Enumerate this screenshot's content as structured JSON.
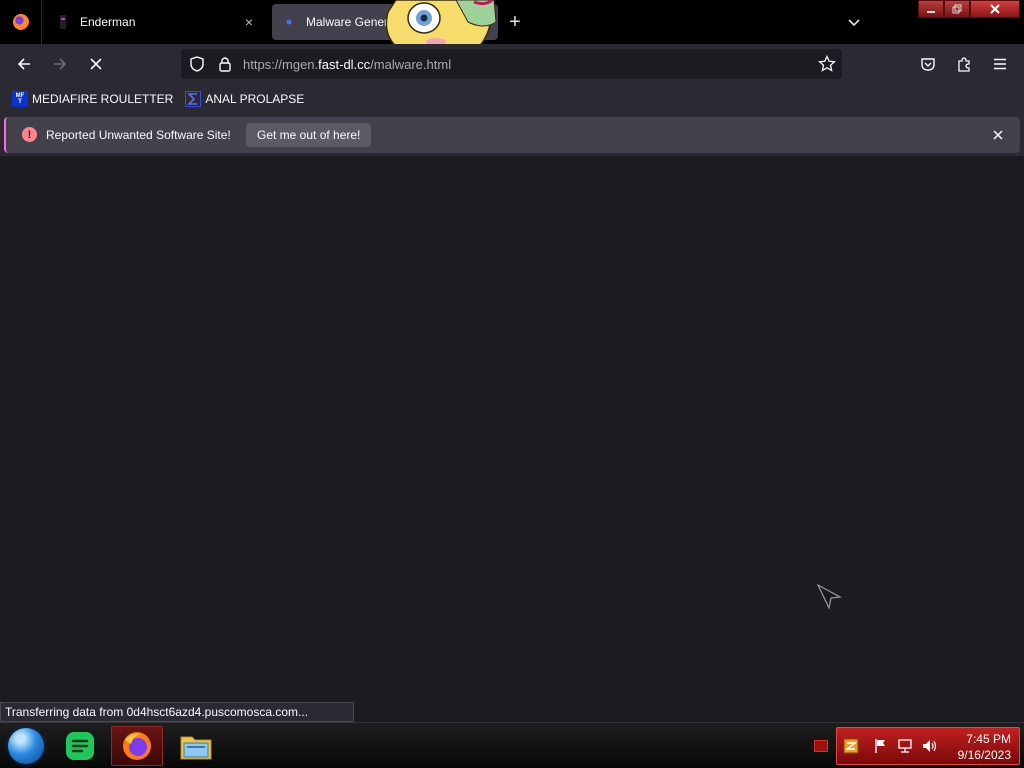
{
  "tabs": [
    {
      "title": "Enderman",
      "active": false
    },
    {
      "title": "Malware Generator",
      "active": true
    }
  ],
  "tab_close_glyph": "×",
  "new_tab_glyph": "+",
  "url": {
    "prefix": "https://mgen.",
    "host": "fast-dl.cc",
    "path": "/malware.html"
  },
  "bookmarks": [
    {
      "label": "MEDIAFIRE ROULETTER",
      "icon": "mediafire-roulette-icon",
      "icon_text": "MF T"
    },
    {
      "label": "ANAL PROLAPSE",
      "icon": "sigma-bookmark-icon"
    }
  ],
  "warning": {
    "text": "Reported Unwanted Software Site!",
    "button": "Get me out of here!",
    "icon_glyph": "!"
  },
  "status_text": "Transferring data from 0d4hsct6azd4.puscomosca.com...",
  "clock": {
    "time": "7:45 PM",
    "date": "9/16/2023"
  },
  "colors": {
    "tab_bar": "#000000",
    "toolbar": "#2b2a33",
    "content": "#1c1b22",
    "warning_accent": "#ff848b",
    "taskbar_tray": "#c22020"
  },
  "taskbar_items": [
    "start-orb",
    "notes-app",
    "firefox",
    "file-explorer"
  ]
}
